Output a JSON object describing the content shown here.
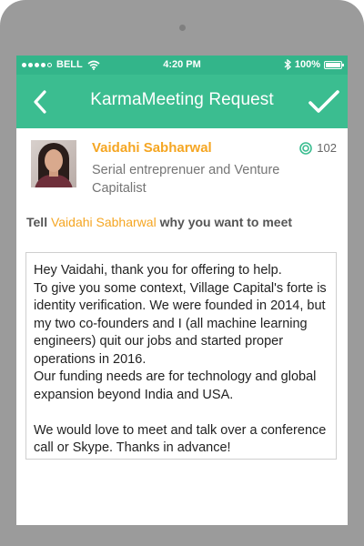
{
  "status_bar": {
    "carrier": "BELL",
    "time": "4:20 PM",
    "battery": "100%"
  },
  "app_bar": {
    "title": "KarmaMeeting Request"
  },
  "profile": {
    "name": "Vaidahi Sabharwal",
    "title": "Serial entreprenuer and Venture Capitalist",
    "karma_count": "102"
  },
  "prompt": {
    "prefix": "Tell",
    "name": "Vaidahi Sabharwal",
    "suffix": "why you want to meet"
  },
  "message": {
    "text": "Hey Vaidahi, thank you for offering to help.\nTo give you some context, Village Capital's forte is identity verification. We were founded in 2014, but my two co-founders and I (all machine learning engineers) quit our jobs and started proper operations in 2016.\nOur funding needs are for technology and global expansion beyond India and USA.\n\nWe would love to meet and talk over a conference call or Skype. Thanks in advance!"
  },
  "colors": {
    "accent_green": "#3bbd90",
    "name_orange": "#f5a623"
  },
  "icons": [
    "back-arrow-icon",
    "checkmark-icon",
    "wifi-icon",
    "bluetooth-icon",
    "battery-icon",
    "karma-icon"
  ]
}
